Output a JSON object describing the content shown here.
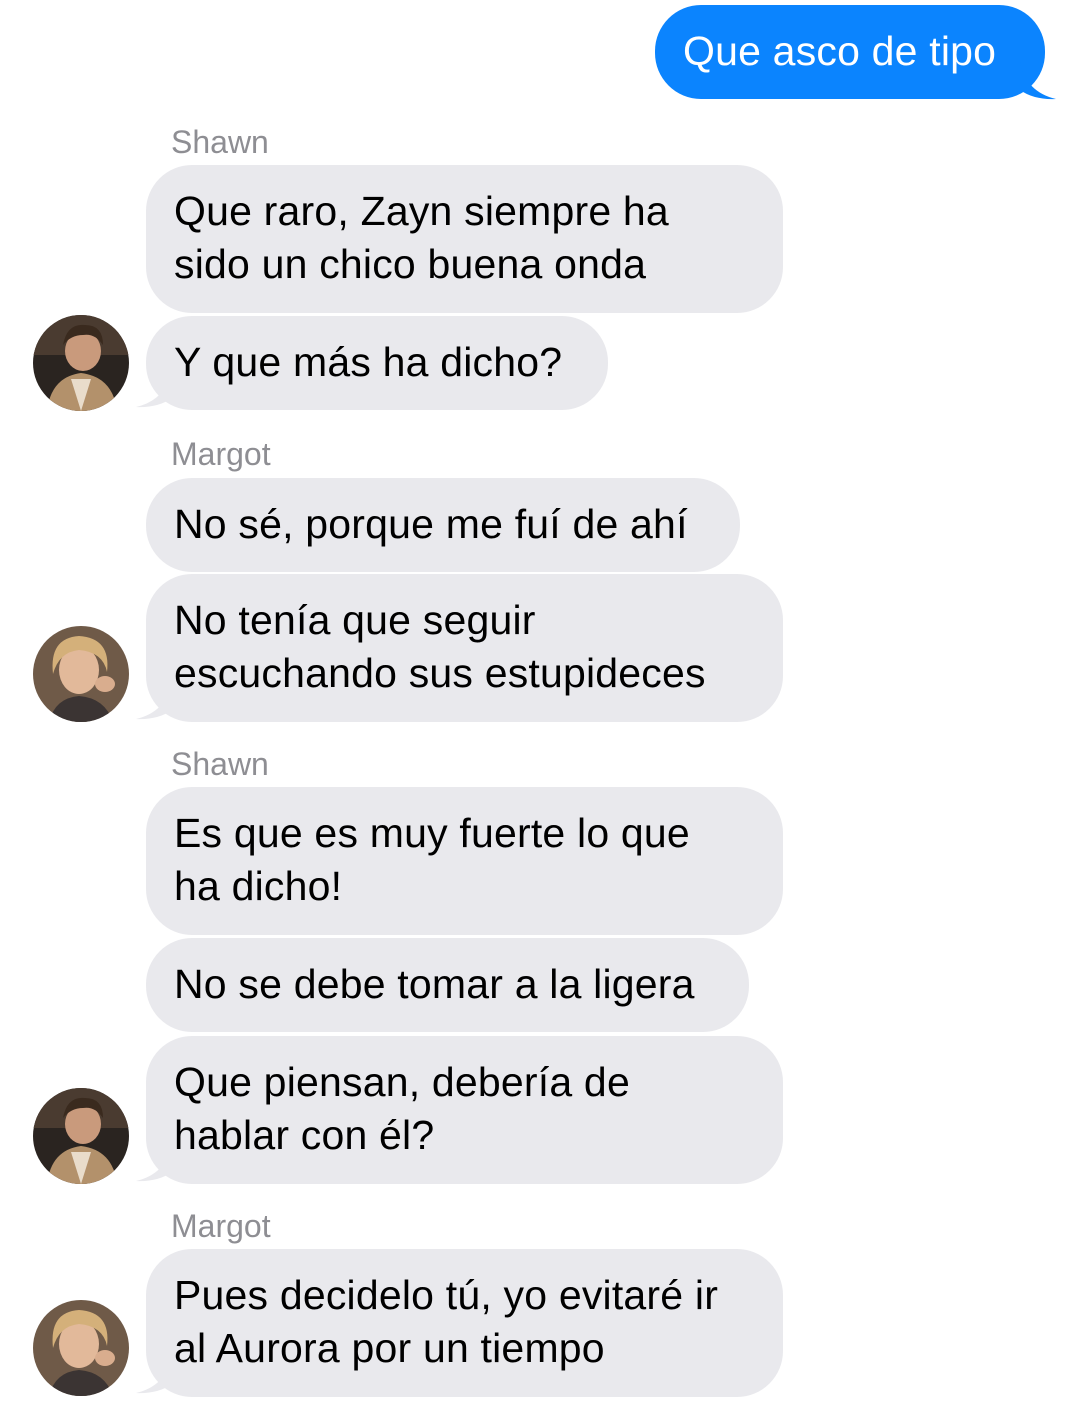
{
  "conversation": {
    "outgoing": [
      {
        "text": "Que asco de tipo"
      }
    ],
    "groups": [
      {
        "sender": "Shawn",
        "avatar_icon": "shawn-avatar",
        "messages": [
          {
            "lines": [
              "Que raro, Zayn siempre ha",
              "sido un chico buena onda"
            ]
          },
          {
            "lines": [
              "Y que más ha dicho?"
            ]
          }
        ]
      },
      {
        "sender": "Margot",
        "avatar_icon": "margot-avatar",
        "messages": [
          {
            "lines": [
              "No sé, porque me fuí de ahí"
            ]
          },
          {
            "lines": [
              "No tenía que seguir",
              "escuchando sus estupideces"
            ]
          }
        ]
      },
      {
        "sender": "Shawn",
        "avatar_icon": "shawn-avatar",
        "messages": [
          {
            "lines": [
              "Es que es muy fuerte lo que",
              "ha dicho!"
            ]
          },
          {
            "lines": [
              "No se debe tomar a la ligera"
            ]
          },
          {
            "lines": [
              "Que piensan, debería de",
              "hablar con él?"
            ]
          }
        ]
      },
      {
        "sender": "Margot",
        "avatar_icon": "margot-avatar",
        "messages": [
          {
            "lines": [
              "Pues decidelo tú, yo evitaré ir",
              "al Aurora por un tiempo"
            ]
          }
        ]
      }
    ]
  },
  "colors": {
    "outgoing_bubble": "#0b84fe",
    "incoming_bubble": "#e9e9ed",
    "sender_label": "#8e8e93"
  }
}
